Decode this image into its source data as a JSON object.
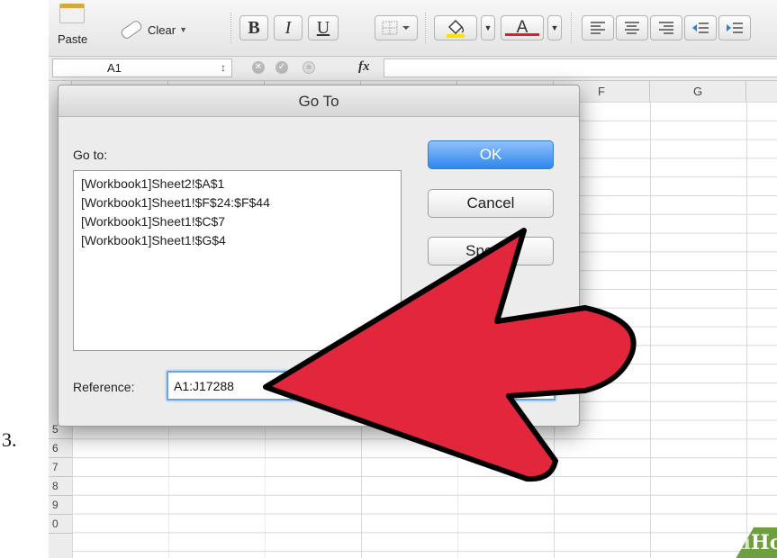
{
  "step_number": "3.",
  "ribbon": {
    "paste_label": "Paste",
    "clear_label": "Clear",
    "bold_label": "B",
    "italic_label": "I",
    "underline_label": "U",
    "font_color_label": "A",
    "fill_color": "#ffe300",
    "font_color": "#e02020"
  },
  "formula_bar": {
    "name_box_value": "A1",
    "name_box_stepper": "↕",
    "fx_label": "fx"
  },
  "grid": {
    "columns": [
      "F",
      "G"
    ],
    "rows": [
      "5",
      "6",
      "7",
      "8",
      "9",
      "0"
    ]
  },
  "dialog": {
    "title": "Go To",
    "goto_label": "Go to:",
    "goto_items": [
      "[Workbook1]Sheet2!$A$1",
      "[Workbook1]Sheet1!$F$24:$F$44",
      "[Workbook1]Sheet1!$C$7",
      "[Workbook1]Sheet1!$G$4"
    ],
    "reference_label": "Reference:",
    "reference_value": "A1:J17288",
    "ok_label": "OK",
    "cancel_label": "Cancel",
    "special_label": "Special"
  },
  "annotation": {
    "arrow_color": "#e2273d",
    "arrow_outline": "#000000"
  },
  "watermark": {
    "prefix": "wiki",
    "suffix": "How"
  }
}
